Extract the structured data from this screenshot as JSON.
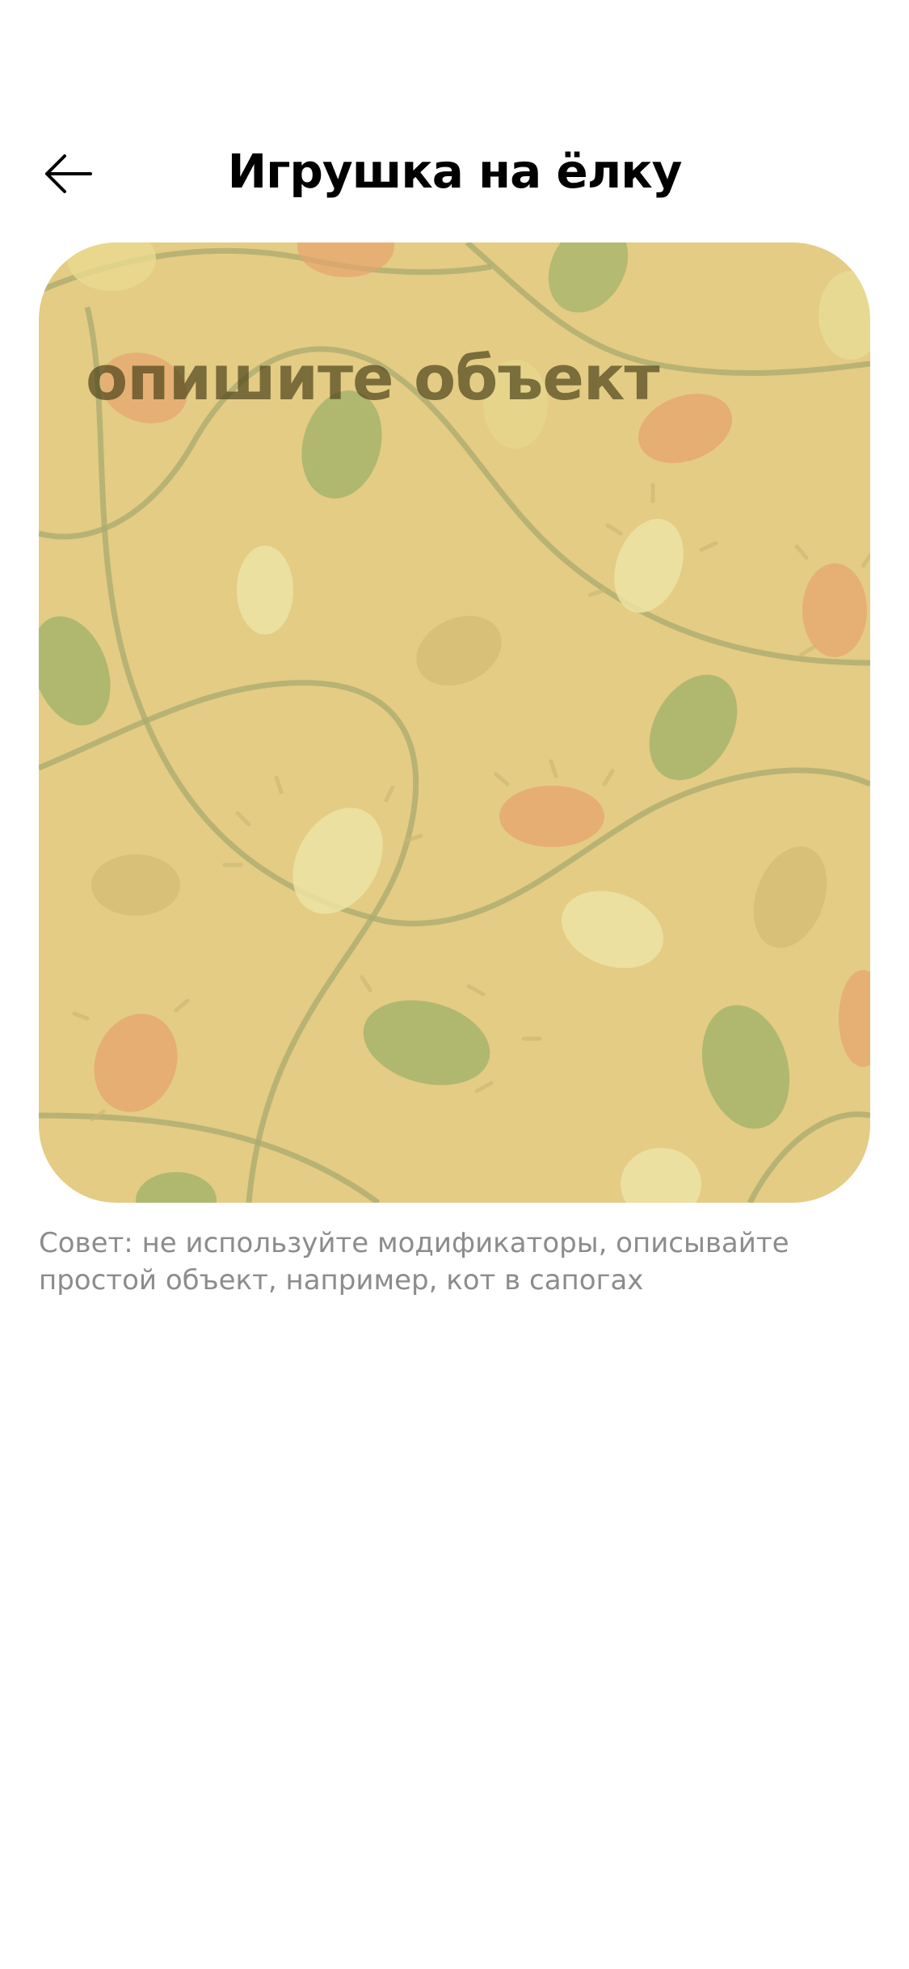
{
  "header": {
    "title": "Игрушка на ёлку",
    "back_icon": "arrow-left-icon"
  },
  "canvas": {
    "placeholder": "опишите объект",
    "value": "",
    "background_color": "#e4cc85",
    "pattern": "christmas-lights-garland"
  },
  "hint": {
    "text": "Совет: не используйте модификаторы, описывайте простой объект, например, кот в сапогах"
  }
}
